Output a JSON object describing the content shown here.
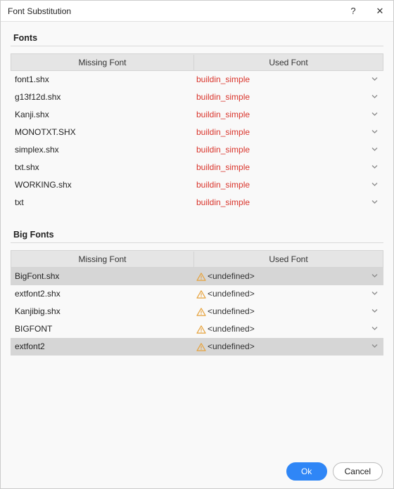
{
  "window": {
    "title": "Font Substitution",
    "help": "?",
    "close": "✕"
  },
  "sections": {
    "fonts": {
      "title": "Fonts",
      "headers": {
        "missing": "Missing Font",
        "used": "Used Font"
      },
      "rows": [
        {
          "missing": "font1.shx",
          "used": "buildin_simple"
        },
        {
          "missing": "g13f12d.shx",
          "used": "buildin_simple"
        },
        {
          "missing": "Kanji.shx",
          "used": "buildin_simple"
        },
        {
          "missing": "MONOTXT.SHX",
          "used": "buildin_simple"
        },
        {
          "missing": "simplex.shx",
          "used": "buildin_simple"
        },
        {
          "missing": "txt.shx",
          "used": "buildin_simple"
        },
        {
          "missing": "WORKING.shx",
          "used": "buildin_simple"
        },
        {
          "missing": "txt",
          "used": "buildin_simple"
        }
      ]
    },
    "bigfonts": {
      "title": "Big Fonts",
      "headers": {
        "missing": "Missing Font",
        "used": "Used Font"
      },
      "rows": [
        {
          "missing": "BigFont.shx",
          "used": "<undefined>",
          "highlight": true
        },
        {
          "missing": "extfont2.shx",
          "used": "<undefined>",
          "highlight": false
        },
        {
          "missing": "Kanjibig.shx",
          "used": "<undefined>",
          "highlight": false
        },
        {
          "missing": "BIGFONT",
          "used": "<undefined>",
          "highlight": false
        },
        {
          "missing": "extfont2",
          "used": "<undefined>",
          "highlight": true
        }
      ]
    }
  },
  "buttons": {
    "ok": "Ok",
    "cancel": "Cancel"
  }
}
